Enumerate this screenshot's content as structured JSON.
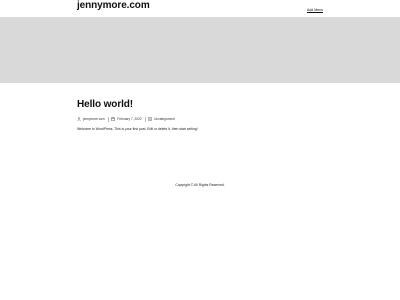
{
  "header": {
    "site_title": "jennymore.com",
    "nav_link": "Add Menu"
  },
  "hero": {
    "background_color": "#d9d9d9"
  },
  "post": {
    "title": "Hello world!",
    "meta": {
      "author": "jennymore.com",
      "date": "February 7, 2022",
      "category": "Uncategorized",
      "author_icon": "person-icon",
      "date_icon": "calendar-icon",
      "category_icon": "folder-icon"
    },
    "content": "Welcome to WordPress. This is your first post. Edit or delete it, then start writing!"
  },
  "footer": {
    "copyright": "Copyright © All Rights Reserved."
  }
}
